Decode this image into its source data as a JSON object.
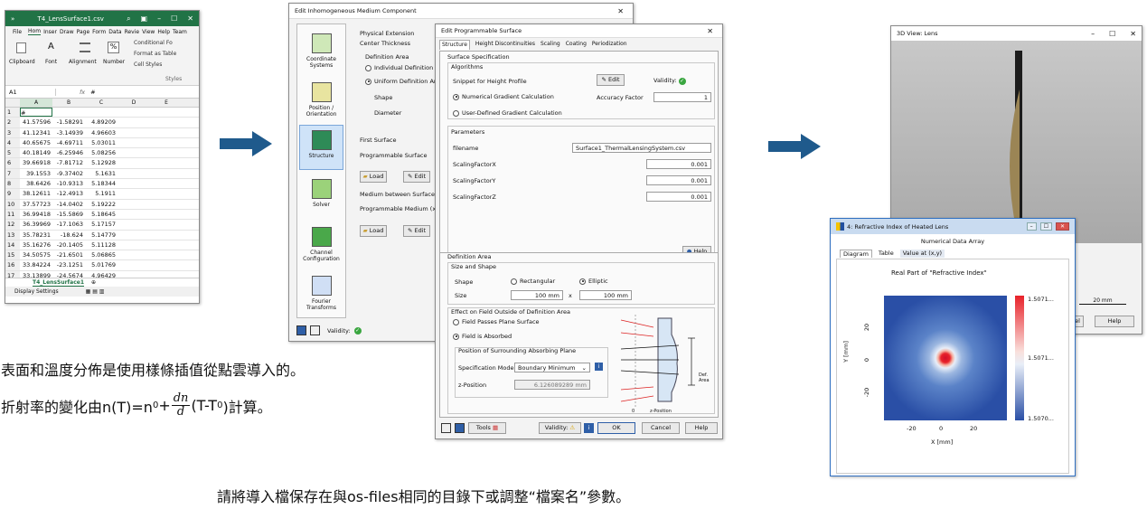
{
  "excel": {
    "title": "T4_LensSurface1.csv",
    "menu": [
      "File",
      "Hom",
      "Inser",
      "Draw",
      "Page",
      "Form",
      "Data",
      "Revie",
      "View",
      "Help",
      "Team"
    ],
    "ribbon": {
      "clipboard": "Clipboard",
      "font": "Font",
      "alignment": "Alignment",
      "number": "Number",
      "cond": "Conditional Fo",
      "format_table": "Format as Table",
      "cell_styles": "Cell Styles",
      "styles": "Styles"
    },
    "namebox": "A1",
    "formula": "#",
    "cols": [
      "A",
      "B",
      "C",
      "D",
      "E"
    ],
    "rows": [
      [
        "1",
        "#",
        "",
        ""
      ],
      [
        "2",
        "41.57596",
        "-1.58291",
        "4.89209"
      ],
      [
        "3",
        "41.12341",
        "-3.14939",
        "4.96603"
      ],
      [
        "4",
        "40.65675",
        "-4.69711",
        "5.03011"
      ],
      [
        "5",
        "40.18149",
        "-6.25946",
        "5.08256"
      ],
      [
        "6",
        "39.66918",
        "-7.81712",
        "5.12928"
      ],
      [
        "7",
        "39.1553",
        "-9.37402",
        "5.1631"
      ],
      [
        "8",
        "38.6426",
        "-10.9313",
        "5.18344"
      ],
      [
        "9",
        "38.12611",
        "-12.4913",
        "5.1911"
      ],
      [
        "10",
        "37.57723",
        "-14.0402",
        "5.19222"
      ],
      [
        "11",
        "36.99418",
        "-15.5869",
        "5.18645"
      ],
      [
        "12",
        "36.39969",
        "-17.1063",
        "5.17157"
      ],
      [
        "13",
        "35.78231",
        "-18.624",
        "5.14779"
      ],
      [
        "14",
        "35.16276",
        "-20.1405",
        "5.11128"
      ],
      [
        "15",
        "34.50575",
        "-21.6501",
        "5.06865"
      ],
      [
        "16",
        "33.84224",
        "-23.1251",
        "5.01769"
      ],
      [
        "17",
        "33.13899",
        "-24.5674",
        "4.96429"
      ],
      [
        "18",
        "32.4145",
        "-25.9622",
        "4.90766"
      ]
    ],
    "sheet_tab": "T4_LensSurface1",
    "status": "Display Settings"
  },
  "medium": {
    "title": "Edit Inhomogeneous Medium Component",
    "side": [
      "Coordinate Systems",
      "Position / Orientation",
      "Structure",
      "Solver",
      "Channel Configuration",
      "Fourier Transforms"
    ],
    "physical_extension": "Physical Extension",
    "center_thickness": "Center Thickness",
    "definition_area": "Definition Area",
    "individual": "Individual Definition Ar",
    "uniform": "Uniform Definition Are",
    "shape": "Shape",
    "diameter": "Diameter",
    "first_surface": "First Surface",
    "programmable_surface": "Programmable Surface",
    "load": "Load",
    "edit": "Edit",
    "medium_between": "Medium between Surfaces",
    "programmable_medium": "Programmable Medium (x-y",
    "validity": "Validity:"
  },
  "surface": {
    "title": "Edit Programmable Surface",
    "tabs": [
      "Structure",
      "Height Discontinuities",
      "Scaling",
      "Coating",
      "Periodization"
    ],
    "surface_spec": "Surface Specification",
    "algorithms": "Algorithms",
    "snippet": "Snippet for Height Profile",
    "edit": "Edit",
    "validity": "Validity:",
    "numerical": "Numerical Gradient Calculation",
    "accuracy": "Accuracy Factor",
    "accuracy_val": "1",
    "userdefined": "User-Defined Gradient Calculation",
    "parameters": "Parameters",
    "params": [
      {
        "name": "filename",
        "value": "Surface1_ThermalLensingSystem.csv"
      },
      {
        "name": "ScalingFactorX",
        "value": "0.001"
      },
      {
        "name": "ScalingFactorY",
        "value": "0.001"
      },
      {
        "name": "ScalingFactorZ",
        "value": "0.001"
      }
    ],
    "help": "Help",
    "def_area": "Definition Area",
    "size_shape": "Size and Shape",
    "shape": "Shape",
    "rect": "Rectangular",
    "elliptic": "Elliptic",
    "size": "Size",
    "size_x": "100 mm",
    "size_y": "100 mm",
    "times": "x",
    "effect": "Effect on Field Outside of Definition Area",
    "passes": "Field Passes Plane Surface",
    "absorbed": "Field is Absorbed",
    "position_plane": "Position of Surrounding Absorbing Plane",
    "spec_mode": "Specification Mode",
    "mode_val": "Boundary Minimum",
    "zpos": "z-Position",
    "zpos_val": "6.126089289 mm",
    "diagram_def": "Def. Area",
    "diagram_zero": "0",
    "diagram_z": "z-Position",
    "tools": "Tools",
    "ok": "OK",
    "cancel": "Cancel"
  },
  "view3d": {
    "title": "3D View: Lens",
    "scale": "20 mm",
    "cancel": "cel",
    "help": "Help"
  },
  "refr": {
    "title": "4: Refractive Index of Heated Lens",
    "subtitle": "Numerical Data Array",
    "tabs": [
      "Diagram",
      "Table",
      "Value at (x,y)"
    ],
    "plot_title": "Real Part of \"Refractive Index\"",
    "ylabel": "Y [mm]",
    "xlabel": "X [mm]",
    "xticks": [
      "-20",
      "0",
      "20"
    ],
    "yticks": [
      "20",
      "0",
      "-20"
    ],
    "cb": [
      "1.5071...",
      "1.5071...",
      "1.5070..."
    ]
  },
  "caption": {
    "line1": "表面和溫度分佈是使用樣條插值從點雲導入的。",
    "line2_a": "折射率的變化由n(T)=n",
    "line2_sub": "0",
    "line2_b": "+",
    "frac_num": "dn",
    "frac_den": "d",
    "line2_c": "(T-T",
    "line2_sub2": "0",
    "line2_d": ")計算。",
    "line3": "請將導入檔保存在與os-files相同的目錄下或調整“檔案名”參數。"
  },
  "colors": {
    "excel_green": "#217346",
    "arrow": "#1f5a8c",
    "hot": "#e8222a",
    "cool": "#2a4fa6"
  }
}
